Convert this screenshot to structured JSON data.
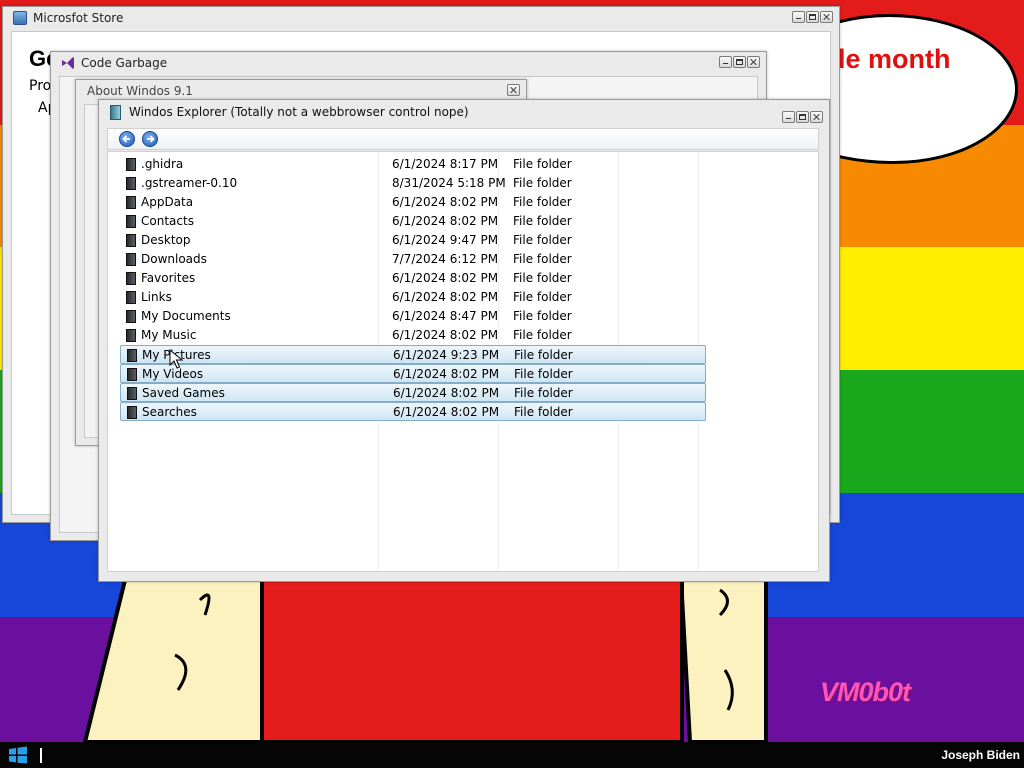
{
  "desktop": {
    "band_colors": [
      "#e31b1b",
      "#f78a00",
      "#ffee00",
      "#19a81b",
      "#1747d8",
      "#6a0f9e"
    ],
    "speech_text": "le month",
    "watermark": "VM0b0t",
    "figure": {
      "shirt_color": "#e31b1b",
      "skin_color": "#fbf2c0"
    }
  },
  "store_window": {
    "title": "Microsfot Store",
    "heading": "Ge",
    "line2": "Pro",
    "line3": "Ap"
  },
  "code_window": {
    "title": "Code Garbage"
  },
  "about_window": {
    "title": "About Windos 9.1"
  },
  "explorer": {
    "title": "Windos Explorer (Totally not a webbrowser control nope)",
    "icons": {
      "back": "back-arrow-icon",
      "forward": "forward-arrow-icon"
    },
    "rows": [
      {
        "name": ".ghidra",
        "date": "6/1/2024 8:17 PM",
        "type": "File folder",
        "selected": false
      },
      {
        "name": ".gstreamer-0.10",
        "date": "8/31/2024 5:18 PM",
        "type": "File folder",
        "selected": false
      },
      {
        "name": "AppData",
        "date": "6/1/2024 8:02 PM",
        "type": "File folder",
        "selected": false
      },
      {
        "name": "Contacts",
        "date": "6/1/2024 8:02 PM",
        "type": "File folder",
        "selected": false
      },
      {
        "name": "Desktop",
        "date": "6/1/2024 9:47 PM",
        "type": "File folder",
        "selected": false
      },
      {
        "name": "Downloads",
        "date": "7/7/2024 6:12 PM",
        "type": "File folder",
        "selected": false
      },
      {
        "name": "Favorites",
        "date": "6/1/2024 8:02 PM",
        "type": "File folder",
        "selected": false
      },
      {
        "name": "Links",
        "date": "6/1/2024 8:02 PM",
        "type": "File folder",
        "selected": false
      },
      {
        "name": "My Documents",
        "date": "6/1/2024 8:47 PM",
        "type": "File folder",
        "selected": false
      },
      {
        "name": "My Music",
        "date": "6/1/2024 8:02 PM",
        "type": "File folder",
        "selected": false
      },
      {
        "name": "My Pictures",
        "date": "6/1/2024 9:23 PM",
        "type": "File folder",
        "selected": true
      },
      {
        "name": "My Videos",
        "date": "6/1/2024 8:02 PM",
        "type": "File folder",
        "selected": true
      },
      {
        "name": "Saved Games",
        "date": "6/1/2024 8:02 PM",
        "type": "File folder",
        "selected": true
      },
      {
        "name": "Searches",
        "date": "6/1/2024 8:02 PM",
        "type": "File folder",
        "selected": true
      }
    ]
  },
  "taskbar": {
    "start_icon": "windows-logo-icon",
    "user_name": "Joseph Biden"
  }
}
